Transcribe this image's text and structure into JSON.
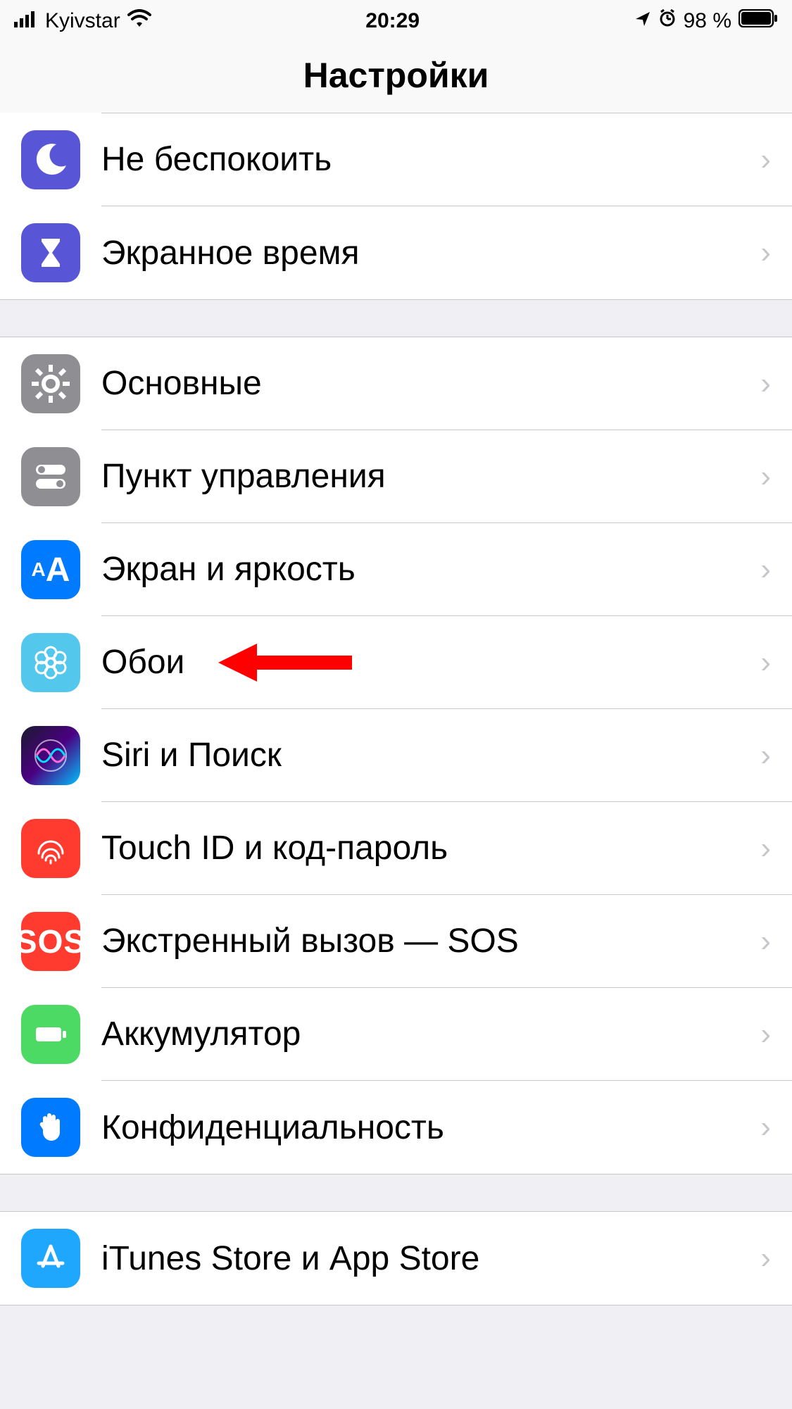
{
  "status_bar": {
    "carrier": "Kyivstar",
    "time": "20:29",
    "battery_pct": "98 %"
  },
  "header": {
    "title": "Настройки"
  },
  "groups": [
    {
      "rows": [
        {
          "key": "dnd",
          "label": "Не беспокоить"
        },
        {
          "key": "screen_time",
          "label": "Экранное время"
        }
      ]
    },
    {
      "rows": [
        {
          "key": "general",
          "label": "Основные"
        },
        {
          "key": "control",
          "label": "Пункт управления"
        },
        {
          "key": "display",
          "label": "Экран и яркость"
        },
        {
          "key": "wallpaper",
          "label": "Обои",
          "highlighted": true
        },
        {
          "key": "siri",
          "label": "Siri и Поиск"
        },
        {
          "key": "touchid",
          "label": "Touch ID и код-пароль"
        },
        {
          "key": "sos",
          "label": "Экстренный вызов — SOS",
          "icon_text": "SOS"
        },
        {
          "key": "battery",
          "label": "Аккумулятор"
        },
        {
          "key": "privacy",
          "label": "Конфиденциальность"
        }
      ]
    },
    {
      "rows": [
        {
          "key": "itunes",
          "label": "iTunes Store и App Store"
        }
      ]
    }
  ]
}
